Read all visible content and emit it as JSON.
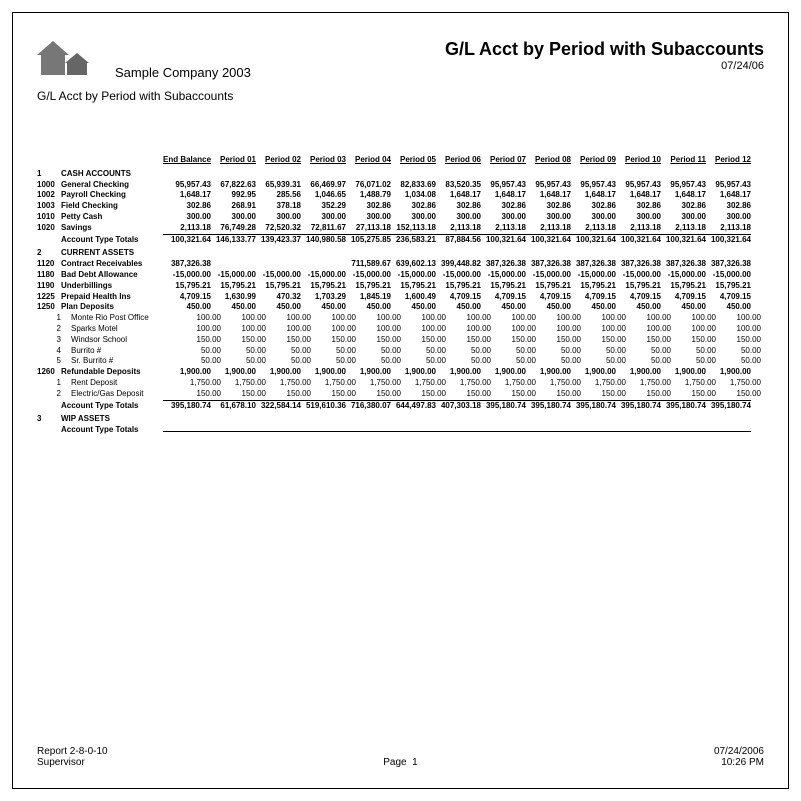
{
  "header": {
    "company": "Sample Company 2003",
    "subtitle": "G/L Acct by Period with Subaccounts",
    "title": "G/L Acct by Period with Subaccounts",
    "title_date": "07/24/06"
  },
  "columns": {
    "end_balance": "End Balance",
    "periods": [
      "Period 01",
      "Period 02",
      "Period 03",
      "Period 04",
      "Period 05",
      "Period 06",
      "Period 07",
      "Period 08",
      "Period 09",
      "Period 10",
      "Period 11",
      "Period 12"
    ]
  },
  "sections": [
    {
      "num": "1",
      "title": "CASH ACCOUNTS",
      "rows": [
        {
          "acct": "1000",
          "desc": "General Checking",
          "endbal": "95,957.43",
          "vals": [
            "67,822.63",
            "65,939.31",
            "66,469.97",
            "76,071.02",
            "82,833.69",
            "83,520.35",
            "95,957.43",
            "95,957.43",
            "95,957.43",
            "95,957.43",
            "95,957.43",
            "95,957.43"
          ],
          "bold": true
        },
        {
          "acct": "1002",
          "desc": "Payroll Checking",
          "endbal": "1,648.17",
          "vals": [
            "992.95",
            "285.56",
            "1,046.65",
            "1,488.79",
            "1,034.08",
            "1,648.17",
            "1,648.17",
            "1,648.17",
            "1,648.17",
            "1,648.17",
            "1,648.17",
            "1,648.17"
          ],
          "bold": true
        },
        {
          "acct": "1003",
          "desc": "Field Checking",
          "endbal": "302.86",
          "vals": [
            "268.91",
            "378.18",
            "352.29",
            "302.86",
            "302.86",
            "302.86",
            "302.86",
            "302.86",
            "302.86",
            "302.86",
            "302.86",
            "302.86"
          ],
          "bold": true
        },
        {
          "acct": "1010",
          "desc": "Petty Cash",
          "endbal": "300.00",
          "vals": [
            "300.00",
            "300.00",
            "300.00",
            "300.00",
            "300.00",
            "300.00",
            "300.00",
            "300.00",
            "300.00",
            "300.00",
            "300.00",
            "300.00"
          ],
          "bold": true
        },
        {
          "acct": "1020",
          "desc": "Savings",
          "endbal": "2,113.18",
          "vals": [
            "76,749.28",
            "72,520.32",
            "72,811.67",
            "27,113.18",
            "152,113.18",
            "2,113.18",
            "2,113.18",
            "2,113.18",
            "2,113.18",
            "2,113.18",
            "2,113.18",
            "2,113.18"
          ],
          "bold": true
        }
      ],
      "totals": {
        "desc": "Account Type Totals",
        "endbal": "100,321.64",
        "vals": [
          "146,133.77",
          "139,423.37",
          "140,980.58",
          "105,275.85",
          "236,583.21",
          "87,884.56",
          "100,321.64",
          "100,321.64",
          "100,321.64",
          "100,321.64",
          "100,321.64",
          "100,321.64"
        ]
      }
    },
    {
      "num": "2",
      "title": "CURRENT ASSETS",
      "rows": [
        {
          "acct": "1120",
          "desc": "Contract Receivables",
          "endbal": "387,326.38",
          "vals": [
            "",
            "",
            "",
            "711,589.67",
            "639,602.13",
            "399,448.82",
            "387,326.38",
            "387,326.38",
            "387,326.38",
            "387,326.38",
            "387,326.38",
            "387,326.38"
          ],
          "bold": true
        },
        {
          "acct": "1180",
          "desc": "Bad Debt Allowance",
          "endbal": "-15,000.00",
          "vals": [
            "-15,000.00",
            "-15,000.00",
            "-15,000.00",
            "-15,000.00",
            "-15,000.00",
            "-15,000.00",
            "-15,000.00",
            "-15,000.00",
            "-15,000.00",
            "-15,000.00",
            "-15,000.00",
            "-15,000.00"
          ],
          "bold": true
        },
        {
          "acct": "1190",
          "desc": "Underbillings",
          "endbal": "15,795.21",
          "vals": [
            "15,795.21",
            "15,795.21",
            "15,795.21",
            "15,795.21",
            "15,795.21",
            "15,795.21",
            "15,795.21",
            "15,795.21",
            "15,795.21",
            "15,795.21",
            "15,795.21",
            "15,795.21"
          ],
          "bold": true
        },
        {
          "acct": "1225",
          "desc": "Prepaid Health Ins",
          "endbal": "4,709.15",
          "vals": [
            "1,630.99",
            "470.32",
            "1,703.29",
            "1,845.19",
            "1,600.49",
            "4,709.15",
            "4,709.15",
            "4,709.15",
            "4,709.15",
            "4,709.15",
            "4,709.15",
            "4,709.15"
          ],
          "bold": true
        },
        {
          "acct": "1250",
          "desc": "Plan Deposits",
          "endbal": "450.00",
          "vals": [
            "450.00",
            "450.00",
            "450.00",
            "450.00",
            "450.00",
            "450.00",
            "450.00",
            "450.00",
            "450.00",
            "450.00",
            "450.00",
            "450.00"
          ],
          "bold": true
        },
        {
          "acct": "1",
          "desc": "Monte Rio Post Office",
          "endbal": "100.00",
          "vals": [
            "100.00",
            "100.00",
            "100.00",
            "100.00",
            "100.00",
            "100.00",
            "100.00",
            "100.00",
            "100.00",
            "100.00",
            "100.00",
            "100.00"
          ],
          "sub": true
        },
        {
          "acct": "2",
          "desc": "Sparks Motel",
          "endbal": "100.00",
          "vals": [
            "100.00",
            "100.00",
            "100.00",
            "100.00",
            "100.00",
            "100.00",
            "100.00",
            "100.00",
            "100.00",
            "100.00",
            "100.00",
            "100.00"
          ],
          "sub": true
        },
        {
          "acct": "3",
          "desc": "Windsor School",
          "endbal": "150.00",
          "vals": [
            "150.00",
            "150.00",
            "150.00",
            "150.00",
            "150.00",
            "150.00",
            "150.00",
            "150.00",
            "150.00",
            "150.00",
            "150.00",
            "150.00"
          ],
          "sub": true
        },
        {
          "acct": "4",
          "desc": "Burrito #",
          "endbal": "50.00",
          "vals": [
            "50.00",
            "50.00",
            "50.00",
            "50.00",
            "50.00",
            "50.00",
            "50.00",
            "50.00",
            "50.00",
            "50.00",
            "50.00",
            "50.00"
          ],
          "sub": true
        },
        {
          "acct": "5",
          "desc": "Sr. Burrito #",
          "endbal": "50.00",
          "vals": [
            "50.00",
            "50.00",
            "50.00",
            "50.00",
            "50.00",
            "50.00",
            "50.00",
            "50.00",
            "50.00",
            "50.00",
            "50.00",
            "50.00"
          ],
          "sub": true
        },
        {
          "acct": "1260",
          "desc": "Refundable Deposits",
          "endbal": "1,900.00",
          "vals": [
            "1,900.00",
            "1,900.00",
            "1,900.00",
            "1,900.00",
            "1,900.00",
            "1,900.00",
            "1,900.00",
            "1,900.00",
            "1,900.00",
            "1,900.00",
            "1,900.00",
            "1,900.00"
          ],
          "bold": true
        },
        {
          "acct": "1",
          "desc": "Rent Deposit",
          "endbal": "1,750.00",
          "vals": [
            "1,750.00",
            "1,750.00",
            "1,750.00",
            "1,750.00",
            "1,750.00",
            "1,750.00",
            "1,750.00",
            "1,750.00",
            "1,750.00",
            "1,750.00",
            "1,750.00",
            "1,750.00"
          ],
          "sub": true
        },
        {
          "acct": "2",
          "desc": "Electric/Gas Deposit",
          "endbal": "150.00",
          "vals": [
            "150.00",
            "150.00",
            "150.00",
            "150.00",
            "150.00",
            "150.00",
            "150.00",
            "150.00",
            "150.00",
            "150.00",
            "150.00",
            "150.00"
          ],
          "sub": true
        }
      ],
      "totals": {
        "desc": "Account Type Totals",
        "endbal": "395,180.74",
        "vals": [
          "61,678.10",
          "322,584.14",
          "519,610.36",
          "716,380.07",
          "644,497.83",
          "407,303.18",
          "395,180.74",
          "395,180.74",
          "395,180.74",
          "395,180.74",
          "395,180.74",
          "395,180.74"
        ]
      }
    },
    {
      "num": "3",
      "title": "WIP ASSETS",
      "rows": [],
      "totals": {
        "desc": "Account Type Totals",
        "endbal": "",
        "vals": [
          "",
          "",
          "",
          "",
          "",
          "",
          "",
          "",
          "",
          "",
          "",
          ""
        ]
      }
    }
  ],
  "footer": {
    "report_label": "Report",
    "report_num": "2-8-0-10",
    "user": "Supervisor",
    "page_label": "Page",
    "page_num": "1",
    "date": "07/24/2006",
    "time": "10:26 PM"
  }
}
